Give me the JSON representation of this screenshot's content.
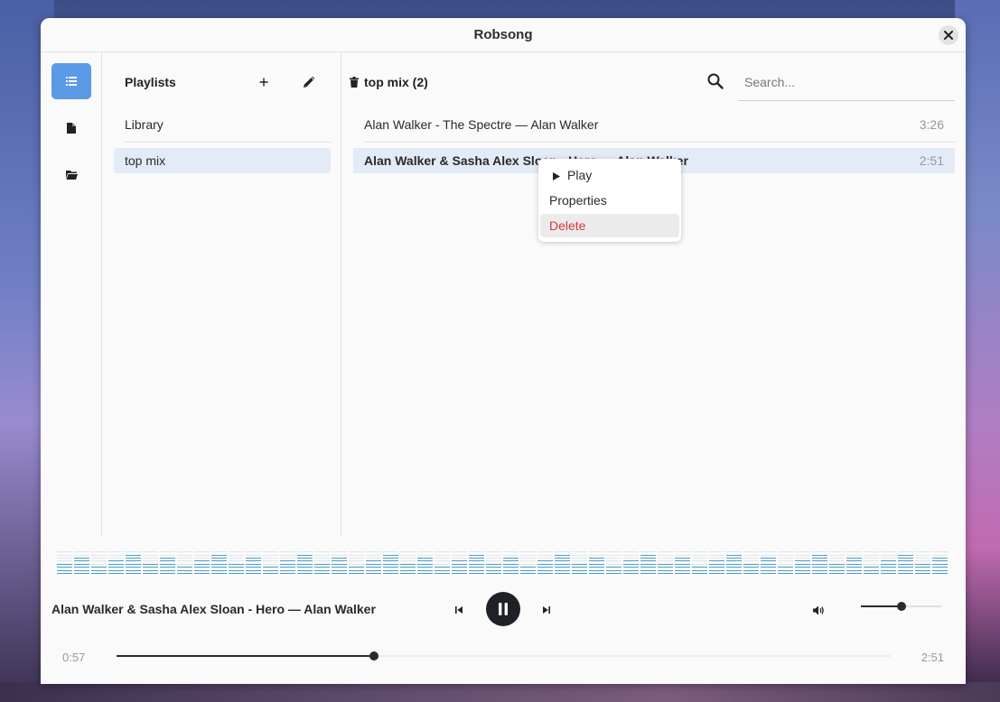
{
  "window": {
    "title": "Robsong"
  },
  "rail": {
    "items": [
      {
        "icon": "playlists-list-icon",
        "active": true
      },
      {
        "icon": "file-icon",
        "active": false
      },
      {
        "icon": "folder-icon",
        "active": false
      }
    ]
  },
  "playlists": {
    "header": "Playlists",
    "items": [
      {
        "label": "Library",
        "selected": false
      },
      {
        "label": "top mix",
        "selected": true
      }
    ]
  },
  "tracks": {
    "header": "top mix (2)",
    "search_placeholder": "Search...",
    "rows": [
      {
        "title": "Alan Walker - The Spectre  —  Alan Walker",
        "duration": "3:26",
        "selected": false
      },
      {
        "title": "Alan Walker & Sasha Alex Sloan - Hero  —  Alan Walker",
        "duration": "2:51",
        "selected": true
      }
    ]
  },
  "context_menu": {
    "items": [
      {
        "label": "Play",
        "icon": "play-triangle-icon"
      },
      {
        "label": "Properties"
      },
      {
        "label": "Delete",
        "danger": true
      }
    ]
  },
  "player": {
    "now_playing": "Alan Walker & Sasha Alex Sloan - Hero  —  Alan Walker",
    "state": "playing",
    "elapsed": "0:57",
    "total": "2:51",
    "progress": 0.333,
    "volume": 0.5
  },
  "colors": {
    "accent": "#5b9ae6",
    "selection": "#e3ebf6",
    "danger": "#d73a3a",
    "visualizer": "#4a9fc7"
  }
}
